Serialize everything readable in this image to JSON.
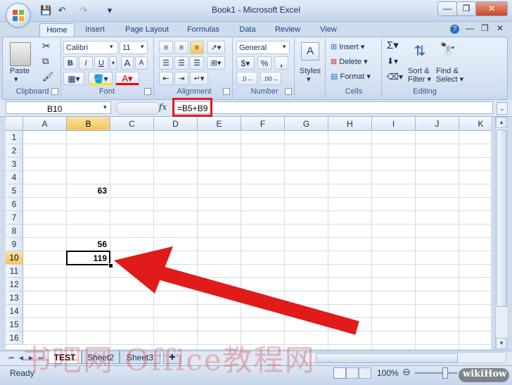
{
  "window": {
    "title": "Book1 - Microsoft Excel",
    "controls": [
      "—",
      "❐",
      "✕"
    ]
  },
  "qat": {
    "save": "💾",
    "undo": "↶",
    "redo": "↷",
    "more": "▾"
  },
  "tabs": [
    "Home",
    "Insert",
    "Page Layout",
    "Formulas",
    "Data",
    "Review",
    "View"
  ],
  "ribbon": {
    "groups": [
      "Clipboard",
      "Font",
      "Alignment",
      "Number",
      "",
      "Cells",
      "Editing"
    ],
    "clipboard": {
      "paste": "Paste"
    },
    "font": {
      "name": "Calibri",
      "size": "11",
      "bold": "B",
      "italic": "I",
      "underline": "U",
      "grow": "A",
      "shrink": "A"
    },
    "number": {
      "format": "General",
      "dollar": "$",
      "percent": "%",
      "comma": ","
    },
    "styles": {
      "label": "Styles"
    },
    "cells": {
      "insert": "Insert",
      "delete": "Delete",
      "format": "Format"
    },
    "editing": {
      "sigma": "Σ",
      "sort": "Sort &",
      "filter": "Filter",
      "find": "Find &",
      "select": "Select"
    }
  },
  "formula_bar": {
    "name_box": "B10",
    "fx": "fx",
    "formula": "=B5+B9"
  },
  "grid": {
    "columns": [
      "A",
      "B",
      "C",
      "D",
      "E",
      "F",
      "G",
      "H",
      "I",
      "J",
      "K"
    ],
    "rows": [
      "1",
      "2",
      "3",
      "4",
      "5",
      "6",
      "7",
      "8",
      "9",
      "10",
      "11",
      "12",
      "13",
      "14",
      "15",
      "16"
    ],
    "cells": {
      "B5": "63",
      "B9": "56",
      "B10": "119"
    },
    "selected_column": "B",
    "selected_row": "10"
  },
  "sheets": [
    "TEST",
    "Sheet2",
    "Sheet3"
  ],
  "status": {
    "text": "Ready",
    "zoom": "100%"
  },
  "watermark": "书吧网 Office教程网",
  "brand": "wikiHow",
  "colors": {
    "accent_red": "#e11a1a",
    "ribbon_blue": "#15428b"
  }
}
